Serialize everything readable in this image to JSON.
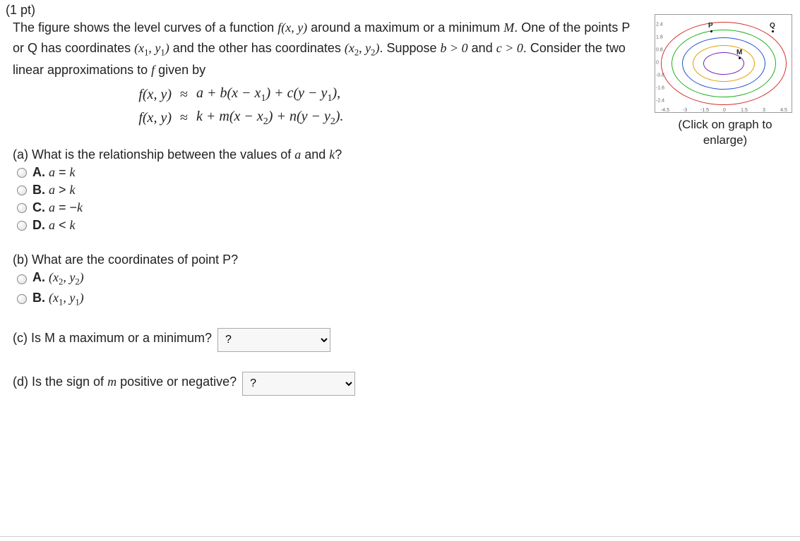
{
  "points": "(1 pt)",
  "question_intro_1": "The figure shows the level curves of a function ",
  "question_intro_2": " around a maximum or a minimum ",
  "question_intro_3": ". One of the points P or Q has coordinates ",
  "question_intro_4": " and the other has coordinates ",
  "question_intro_5": ". Suppose ",
  "question_intro_6": " and ",
  "question_intro_7": ". Consider the two linear approximations to ",
  "question_intro_8": " given by",
  "fxy": "f(x, y)",
  "fxy_plain": "f(x,y)",
  "M": "M",
  "b_cond": "b > 0",
  "c_cond": "c > 0",
  "f_only": "f",
  "xy1": "(x₁, y₁)",
  "xy2": "(x₂, y₂)",
  "eq1_left": "f(x, y)",
  "eq_approx": "≈",
  "eq1_right": "a + b(x − x₁) + c(y − y₁),",
  "eq2_left": "f(x, y)",
  "eq2_right": "k + m(x − x₂) + n(y − y₂).",
  "part_a": {
    "question": "(a) What is the relationship between the values of ",
    "a_var": "a",
    "and_text": " and ",
    "k_var": "k",
    "qmark": "?",
    "options": {
      "A": "A. a = k",
      "B": "B. a > k",
      "C": "C. a = −k",
      "D": "D. a < k"
    }
  },
  "part_b": {
    "question": "(b) What are the coordinates of point P?",
    "options": {
      "A_pref": "A. ",
      "A_math": "(x₂, y₂)",
      "B_pref": "B. ",
      "B_math": "(x₁, y₁)"
    }
  },
  "part_c": {
    "question": "(c) Is M a maximum or a minimum?",
    "placeholder": "?"
  },
  "part_d": {
    "question_prefix": "(d) Is the sign of ",
    "m_var": "m",
    "question_suffix": " positive or negative?",
    "placeholder": "?"
  },
  "graph": {
    "caption": "(Click on graph to enlarge)",
    "point_P": "P",
    "point_Q": "Q",
    "point_M": "M",
    "ellipse_colors": [
      "#d92b2b",
      "#20b020",
      "#2050d0",
      "#e0a000",
      "#7020b0"
    ],
    "xticks": [
      "-4.5",
      "-3",
      "-1.5",
      "0",
      "1.5",
      "3",
      "4.5"
    ],
    "yticks": [
      "2.4",
      "1.8",
      "0.8",
      "0",
      "-0.8",
      "-1.6",
      "-2.4"
    ]
  }
}
